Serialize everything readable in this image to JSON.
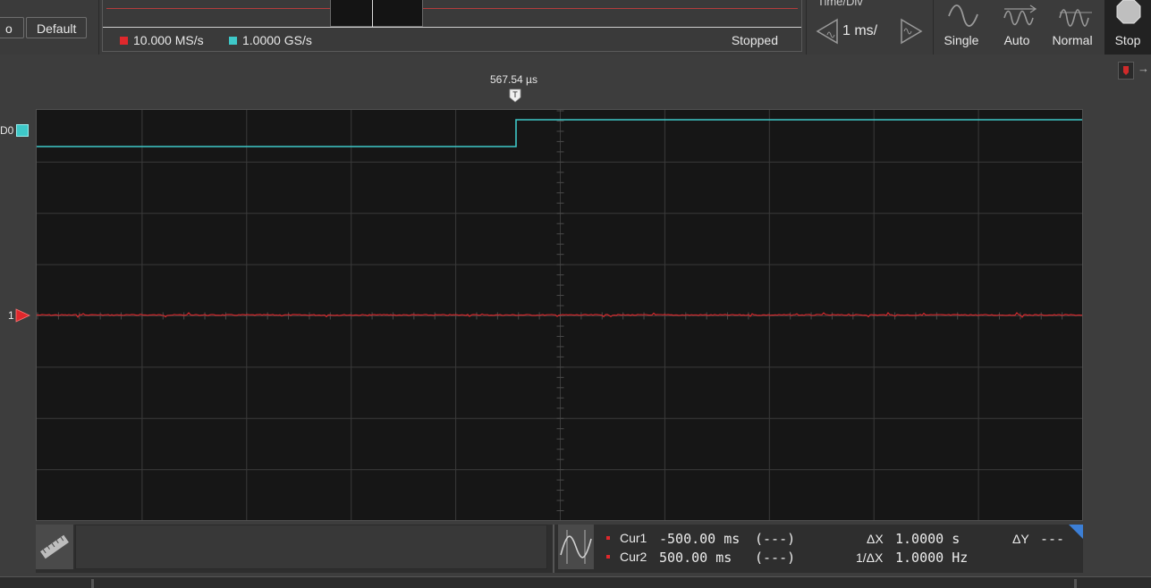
{
  "toolbar": {
    "partial_button_label": "o",
    "default_button_label": "Default"
  },
  "overview": {
    "rate1": {
      "color": "#e0282c",
      "text": "10.000 MS/s"
    },
    "rate2": {
      "color": "#3ec8c8",
      "text": "1.0000 GS/s"
    },
    "status": "Stopped"
  },
  "timebase": {
    "title": "Time/Div",
    "value": "1 ms/"
  },
  "trigger_modes": [
    {
      "label": "Single",
      "icon": "single-wave-icon"
    },
    {
      "label": "Auto",
      "icon": "auto-wave-icon"
    },
    {
      "label": "Normal",
      "icon": "normal-wave-icon"
    },
    {
      "label": "Stop",
      "icon": "stop-icon"
    }
  ],
  "scope": {
    "trigger_time": "567.54 µs",
    "trigger_marker_label": "T",
    "digital_channel_label": "D0",
    "analog_channel_label": "1",
    "colors": {
      "digital": "#3ec8c8",
      "analog": "#d2282c",
      "grid": "#3a3a3a"
    }
  },
  "cursors": {
    "cur1": {
      "label": "Cur1",
      "value": "-500.00 ms",
      "extra": "(---)"
    },
    "cur2": {
      "label": "Cur2",
      "value": "500.00 ms",
      "extra": "(---)"
    },
    "dx": {
      "label": "ΔX",
      "value": "1.0000 s"
    },
    "inv_dx": {
      "label": "1/ΔX",
      "value": "1.0000 Hz"
    },
    "dy": {
      "label": "ΔY",
      "value": "---"
    }
  }
}
